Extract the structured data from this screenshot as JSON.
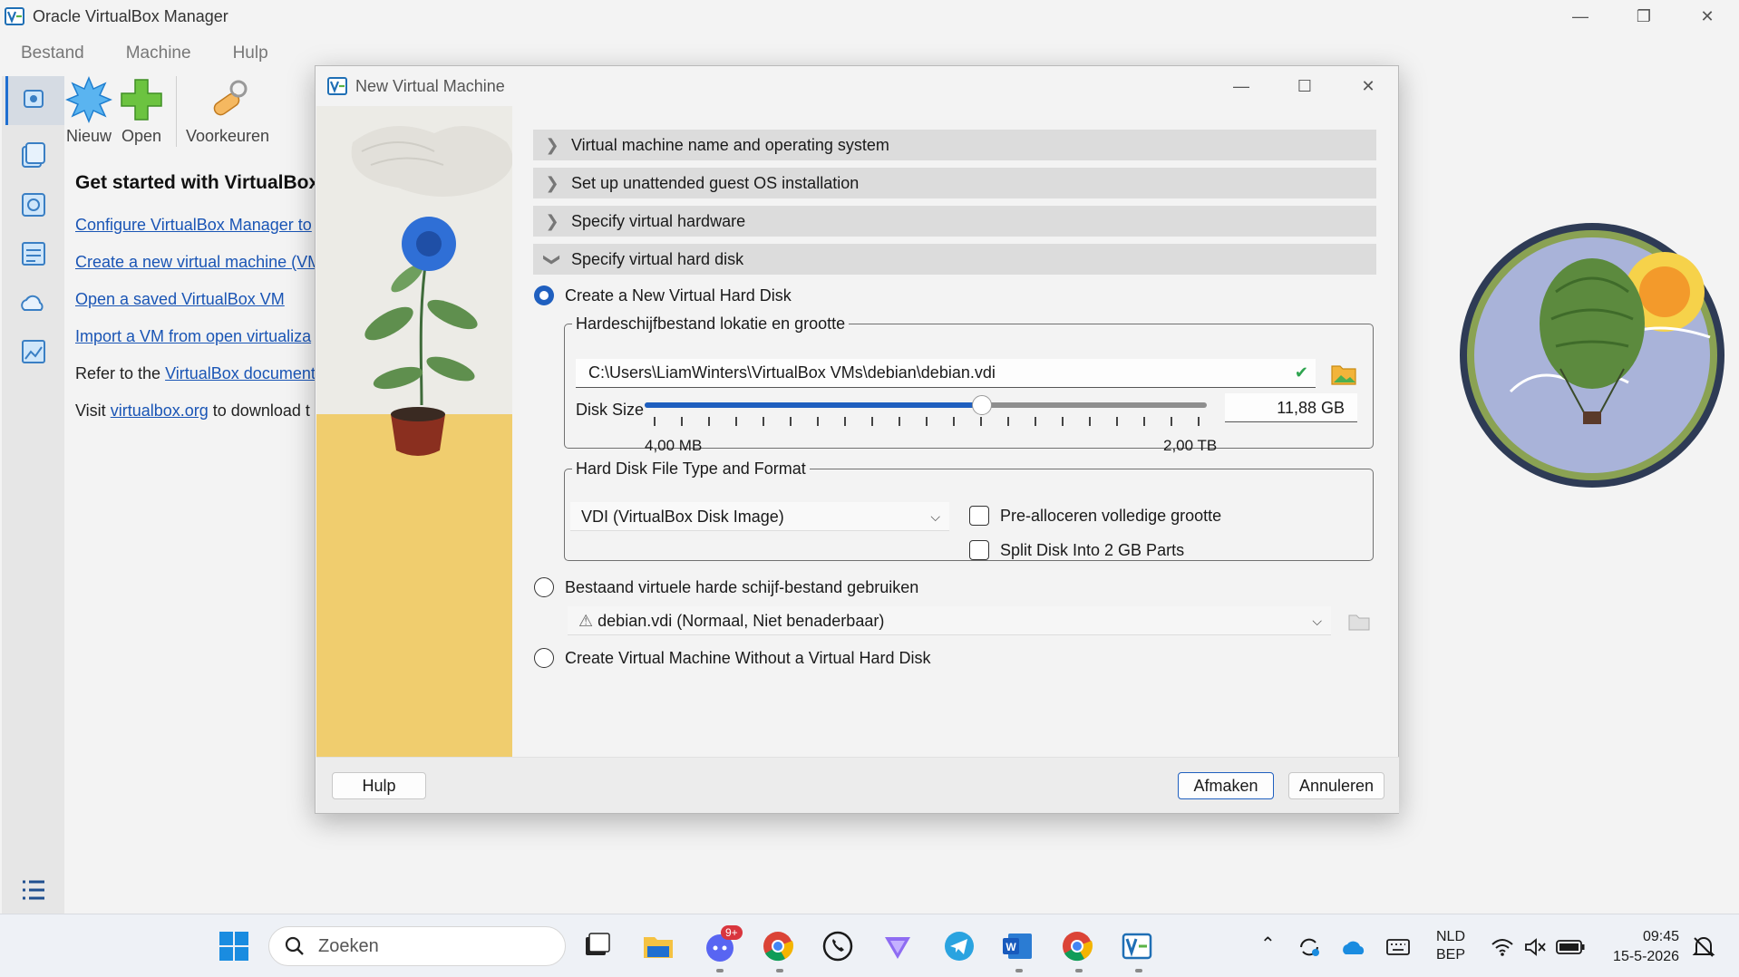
{
  "window": {
    "title": "Oracle VirtualBox Manager"
  },
  "menu": [
    "Bestand",
    "Machine",
    "Hulp"
  ],
  "toolbar": {
    "new_label": "Nieuw",
    "open_label": "Open",
    "prefs_label": "Voorkeuren"
  },
  "welcome": {
    "heading": "Get started with VirtualBox",
    "link1": "Configure VirtualBox Manager to",
    "link2": "Create a new virtual machine (VM",
    "link3": "Open a saved VirtualBox VM",
    "link4": "Import a VM from open virtualiza",
    "refer_prefix": "Refer to the",
    "refer_link": "VirtualBox document",
    "visit_prefix": "Visit",
    "visit_link": "virtualbox.org",
    "visit_suffix": "to download t"
  },
  "dialog": {
    "title": "New Virtual Machine",
    "sections": [
      "Virtual machine name and operating system",
      "Set up unattended guest OS installation",
      "Specify virtual hardware",
      "Specify virtual hard disk"
    ],
    "create_new_label": "Create a New Virtual Hard Disk",
    "location_group_label": "Hardeschijfbestand lokatie en grootte",
    "file_path": "C:\\Users\\LiamWinters\\VirtualBox VMs\\debian\\debian.vdi",
    "disk_size_label": "Disk Size",
    "disk_size_value": "11,88 GB",
    "disk_size_position": 0.6,
    "disk_size_min": "4,00 MB",
    "disk_size_max": "2,00 TB",
    "format_group_label": "Hard Disk File Type and Format",
    "format_value": "VDI (VirtualBox Disk Image)",
    "prealloc_label": "Pre-alloceren volledige grootte",
    "split_label": "Split Disk Into 2 GB Parts",
    "use_existing_label": "Bestaand virtuele harde schijf-bestand gebruiken",
    "existing_value": "debian.vdi (Normaal, Niet benaderbaar)",
    "no_disk_label": "Create Virtual Machine Without a Virtual Hard Disk",
    "help_button": "Hulp",
    "finish_button": "Afmaken",
    "cancel_button": "Annuleren"
  },
  "taskbar": {
    "search_placeholder": "Zoeken",
    "discord_badge": "9+",
    "lang_top": "NLD",
    "lang_bottom": "BEP",
    "time": "09:45",
    "date": "15-5-2026"
  },
  "colors": {
    "accent": "#1f5fbf",
    "link": "#1a55b5"
  }
}
